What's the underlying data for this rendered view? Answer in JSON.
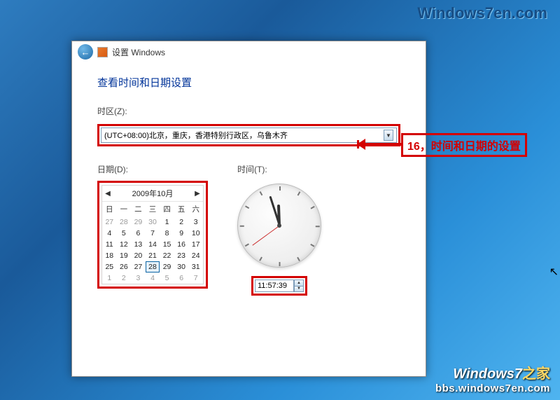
{
  "logos": {
    "top": "Windows7en.com",
    "bottom_line1_a": "Windows7",
    "bottom_line1_b": "之家",
    "bottom_line2": "bbs.windows7en.com"
  },
  "window": {
    "title": "设置 Windows",
    "heading": "查看时间和日期设置"
  },
  "timezone": {
    "label": "时区(Z):",
    "value": "(UTC+08:00)北京，重庆，香港特别行政区，乌鲁木齐"
  },
  "date": {
    "label": "日期(D):",
    "month_title": "2009年10月",
    "dow": [
      "日",
      "一",
      "二",
      "三",
      "四",
      "五",
      "六"
    ],
    "cells": [
      {
        "n": "27",
        "g": true
      },
      {
        "n": "28",
        "g": true
      },
      {
        "n": "29",
        "g": true
      },
      {
        "n": "30",
        "g": true
      },
      {
        "n": "1"
      },
      {
        "n": "2"
      },
      {
        "n": "3"
      },
      {
        "n": "4"
      },
      {
        "n": "5"
      },
      {
        "n": "6"
      },
      {
        "n": "7"
      },
      {
        "n": "8"
      },
      {
        "n": "9"
      },
      {
        "n": "10"
      },
      {
        "n": "11"
      },
      {
        "n": "12"
      },
      {
        "n": "13"
      },
      {
        "n": "14"
      },
      {
        "n": "15"
      },
      {
        "n": "16"
      },
      {
        "n": "17"
      },
      {
        "n": "18"
      },
      {
        "n": "19"
      },
      {
        "n": "20"
      },
      {
        "n": "21"
      },
      {
        "n": "22"
      },
      {
        "n": "23"
      },
      {
        "n": "24"
      },
      {
        "n": "25"
      },
      {
        "n": "26"
      },
      {
        "n": "27"
      },
      {
        "n": "28",
        "sel": true
      },
      {
        "n": "29"
      },
      {
        "n": "30"
      },
      {
        "n": "31"
      },
      {
        "n": "1",
        "g": true
      },
      {
        "n": "2",
        "g": true
      },
      {
        "n": "3",
        "g": true
      },
      {
        "n": "4",
        "g": true
      },
      {
        "n": "5",
        "g": true
      },
      {
        "n": "6",
        "g": true
      },
      {
        "n": "7",
        "g": true
      }
    ]
  },
  "time": {
    "label": "时间(T):",
    "value": "11:57:39"
  },
  "callout": {
    "text": "16，时间和日期的设置"
  }
}
